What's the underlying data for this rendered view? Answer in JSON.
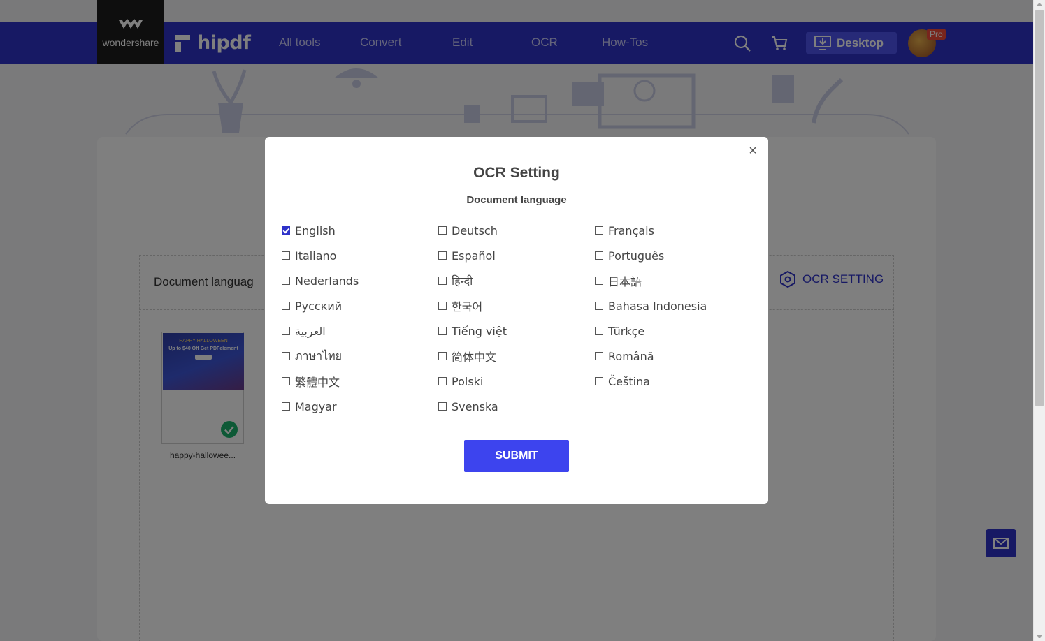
{
  "nav": {
    "logo_text": "wondershare",
    "brand": "hipdf",
    "links": [
      "All tools",
      "Convert",
      "Edit",
      "OCR",
      "How-Tos"
    ],
    "desktop_label": "Desktop",
    "pro_badge": "Pro"
  },
  "page": {
    "document_language_label": "Document languag",
    "ocr_setting_link": "OCR SETTING",
    "thumbnail": {
      "banner_line1": "HAPPY HALLOWEEN",
      "banner_line2": "Up to $40 Off Get PDFelement"
    },
    "file_name": "happy-hallowee..."
  },
  "modal": {
    "title": "OCR Setting",
    "subtitle": "Document language",
    "close_symbol": "×",
    "languages": [
      {
        "label": "English",
        "checked": true
      },
      {
        "label": "Deutsch",
        "checked": false
      },
      {
        "label": "Français",
        "checked": false
      },
      {
        "label": "Italiano",
        "checked": false
      },
      {
        "label": "Español",
        "checked": false
      },
      {
        "label": "Português",
        "checked": false
      },
      {
        "label": "Nederlands",
        "checked": false
      },
      {
        "label": "हिन्दी",
        "checked": false
      },
      {
        "label": "日本語",
        "checked": false
      },
      {
        "label": "Русский",
        "checked": false
      },
      {
        "label": "한국어",
        "checked": false
      },
      {
        "label": "Bahasa Indonesia",
        "checked": false
      },
      {
        "label": "العربية",
        "checked": false
      },
      {
        "label": "Tiếng việt",
        "checked": false
      },
      {
        "label": "Türkçe",
        "checked": false
      },
      {
        "label": "ภาษาไทย",
        "checked": false
      },
      {
        "label": "简体中文",
        "checked": false
      },
      {
        "label": "Română",
        "checked": false
      },
      {
        "label": "繁體中文",
        "checked": false
      },
      {
        "label": "Polski",
        "checked": false
      },
      {
        "label": "Čeština",
        "checked": false
      },
      {
        "label": "Magyar",
        "checked": false
      },
      {
        "label": "Svenska",
        "checked": false
      }
    ],
    "submit_label": "SUBMIT"
  },
  "colors": {
    "nav_bg": "#2e32c9",
    "accent": "#3d44ee",
    "success": "#1bb36c"
  }
}
